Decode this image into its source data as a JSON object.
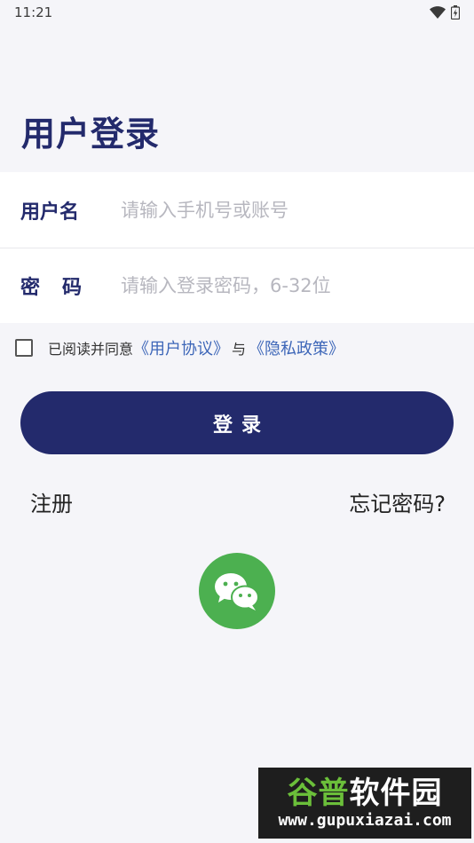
{
  "status": {
    "time": "11:21"
  },
  "title": "用户登录",
  "form": {
    "username": {
      "label": "用户名",
      "placeholder": "请输入手机号或账号"
    },
    "password": {
      "label": "密码",
      "placeholder": "请输入登录密码，6-32位"
    }
  },
  "agreement": {
    "prefix": "已阅读并同意",
    "user_agreement": "《用户协议》",
    "and": "与",
    "privacy_policy": "《隐私政策》",
    "checked": false
  },
  "login_label": "登录",
  "register_label": "注册",
  "forgot_label": "忘记密码?",
  "wechat_icon": "wechat-icon",
  "watermark": {
    "title_part1": "谷普",
    "title_part2": "软件园",
    "url": "www.gupuxiazai.com"
  },
  "colors": {
    "primary": "#232a6c",
    "link": "#3d66b8",
    "wechat": "#4cb050",
    "background": "#f5f5f9"
  }
}
